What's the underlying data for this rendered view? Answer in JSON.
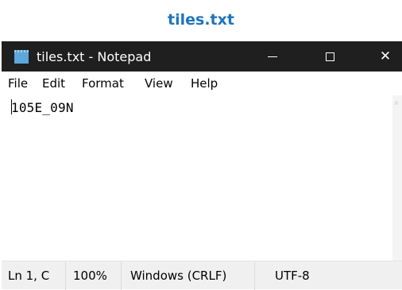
{
  "caption": "tiles.txt",
  "window": {
    "title": "tiles.txt - Notepad",
    "controls": {
      "minimize_icon": "minimize-icon",
      "maximize_icon": "maximize-icon",
      "close_icon": "close-icon",
      "close_glyph": "✕"
    }
  },
  "menu": {
    "items": [
      {
        "label": "File"
      },
      {
        "label": "Edit"
      },
      {
        "label": "Format"
      },
      {
        "label": "View"
      },
      {
        "label": "Help"
      }
    ]
  },
  "editor": {
    "content": "105E_09N"
  },
  "scrollbars": {
    "left_arrow": "<",
    "right_arrow": ">"
  },
  "status": {
    "position": "Ln 1, C",
    "zoom": "100%",
    "line_endings": "Windows (CRLF)",
    "encoding": "UTF-8"
  },
  "colors": {
    "caption": "#1f74be",
    "titlebar": "#1f1f1f"
  }
}
